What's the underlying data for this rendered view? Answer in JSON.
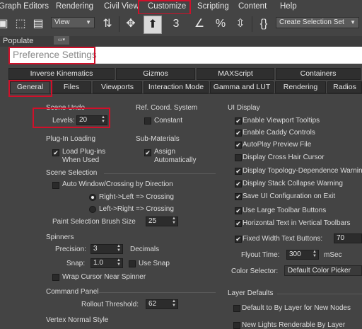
{
  "menubar": {
    "items": [
      "Graph Editors",
      "Rendering",
      "Civil View",
      "Customize",
      "Scripting",
      "Content",
      "Help"
    ]
  },
  "toolbar": {
    "view_combo": "View",
    "selection_set": "Create Selection Set"
  },
  "populate": {
    "label": "Populate"
  },
  "dialog": {
    "title": "Preference Settings"
  },
  "tabs": {
    "row1": [
      "Inverse Kinematics",
      "Gizmos",
      "MAXScript",
      "Containers"
    ],
    "row2": [
      "General",
      "Files",
      "Viewports",
      "Interaction Mode",
      "Gamma and LUT",
      "Rendering",
      "Radios"
    ]
  },
  "scene_undo": {
    "title": "Scene Undo",
    "levels_label": "Levels:",
    "levels_value": "20"
  },
  "ref_coord": {
    "title": "Ref. Coord. System",
    "constant": "Constant"
  },
  "plugin_loading": {
    "title": "Plug-In Loading",
    "load_line1": "Load Plug-ins",
    "load_line2": "When Used"
  },
  "sub_materials": {
    "title": "Sub-Materials",
    "assign_line1": "Assign",
    "assign_line2": "Automatically"
  },
  "scene_selection": {
    "title": "Scene Selection",
    "auto_window": "Auto Window/Crossing by Direction",
    "right_left": "Right->Left => Crossing",
    "left_right": "Left->Right => Crossing",
    "paint_label": "Paint Selection Brush Size",
    "paint_value": "25"
  },
  "spinners": {
    "title": "Spinners",
    "precision_label": "Precision:",
    "precision_value": "3",
    "decimals": "Decimals",
    "snap_label": "Snap:",
    "snap_value": "1.0",
    "use_snap": "Use Snap",
    "wrap": "Wrap Cursor Near Spinner"
  },
  "command_panel": {
    "title": "Command Panel",
    "rollout_label": "Rollout Threshold:",
    "rollout_value": "62"
  },
  "vertex_normal": {
    "title": "Vertex Normal Style"
  },
  "ui_display": {
    "title": "UI Display",
    "options": [
      "Enable Viewport Tooltips",
      "Enable Caddy Controls",
      "AutoPlay Preview File",
      "Display Cross Hair Cursor",
      "Display Topology-Dependence Warning",
      "Display Stack Collapse Warning",
      "Save UI Configuration on Exit",
      "Use Large Toolbar Buttons",
      "Horizontal Text in Vertical Toolbars",
      "Fixed Width Text Buttons:"
    ],
    "fixed_width_value": "70",
    "flyout_label": "Flyout Time:",
    "flyout_value": "300",
    "msec": "mSec",
    "color_selector_label": "Color Selector:",
    "color_selector_value": "Default Color Picker"
  },
  "layer_defaults": {
    "title": "Layer Defaults",
    "default_bylayer": "Default to By Layer for New Nodes",
    "new_lights": "New Lights Renderable By Layer"
  },
  "colors": {
    "highlight": "#d0102a",
    "panel": "#444444",
    "field": "#2c2c2c"
  }
}
